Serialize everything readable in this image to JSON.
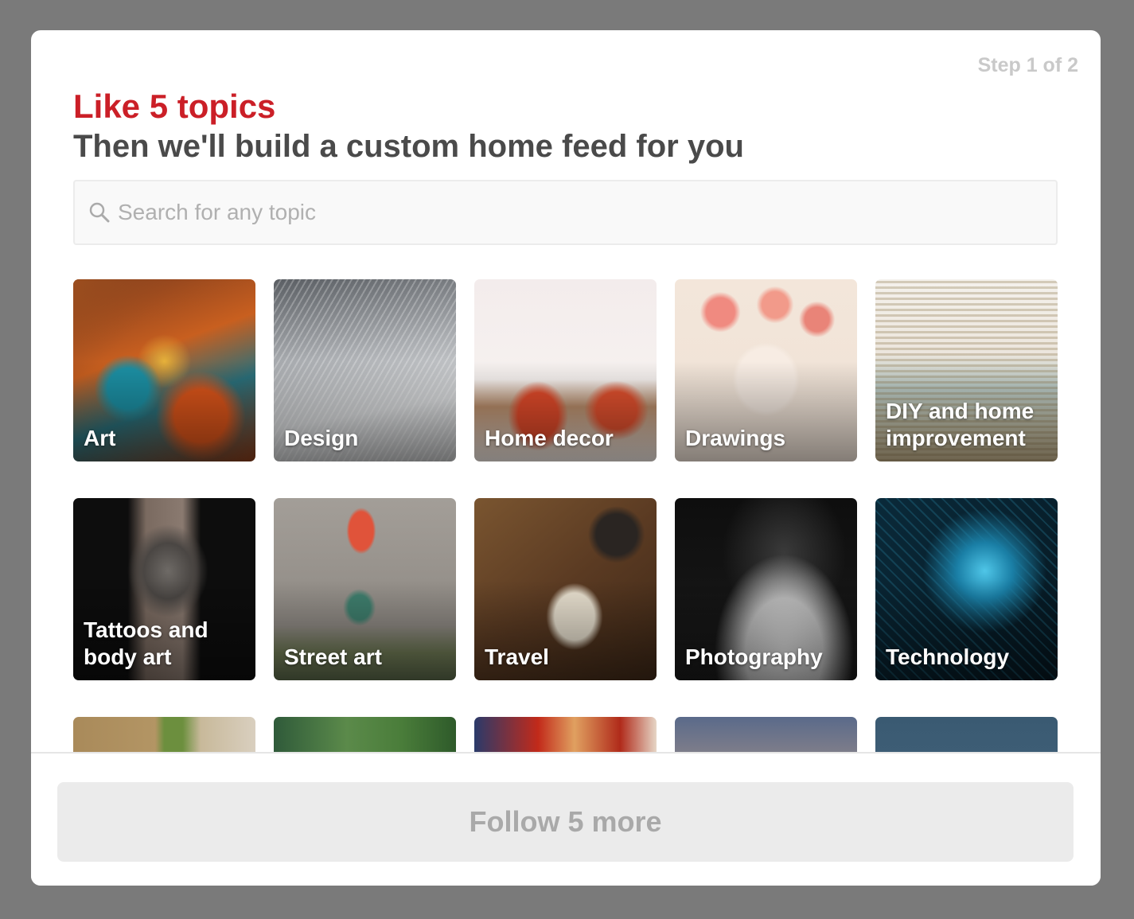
{
  "step": "Step 1 of 2",
  "title": "Like 5 topics",
  "subtitle": "Then we'll build a custom home feed for you",
  "search": {
    "placeholder": "Search for any topic",
    "icon": "search-icon"
  },
  "topics": [
    {
      "label": "Art"
    },
    {
      "label": "Design"
    },
    {
      "label": "Home decor"
    },
    {
      "label": "Drawings"
    },
    {
      "label": "DIY and home improvement"
    },
    {
      "label": "Tattoos and body art"
    },
    {
      "label": "Street art"
    },
    {
      "label": "Travel"
    },
    {
      "label": "Photography"
    },
    {
      "label": "Technology"
    }
  ],
  "follow_button": "Follow 5 more",
  "colors": {
    "accent": "#cb1f27",
    "heading": "#4a4a4a",
    "muted": "#c9c9c9",
    "button_bg": "#ebebeb"
  }
}
